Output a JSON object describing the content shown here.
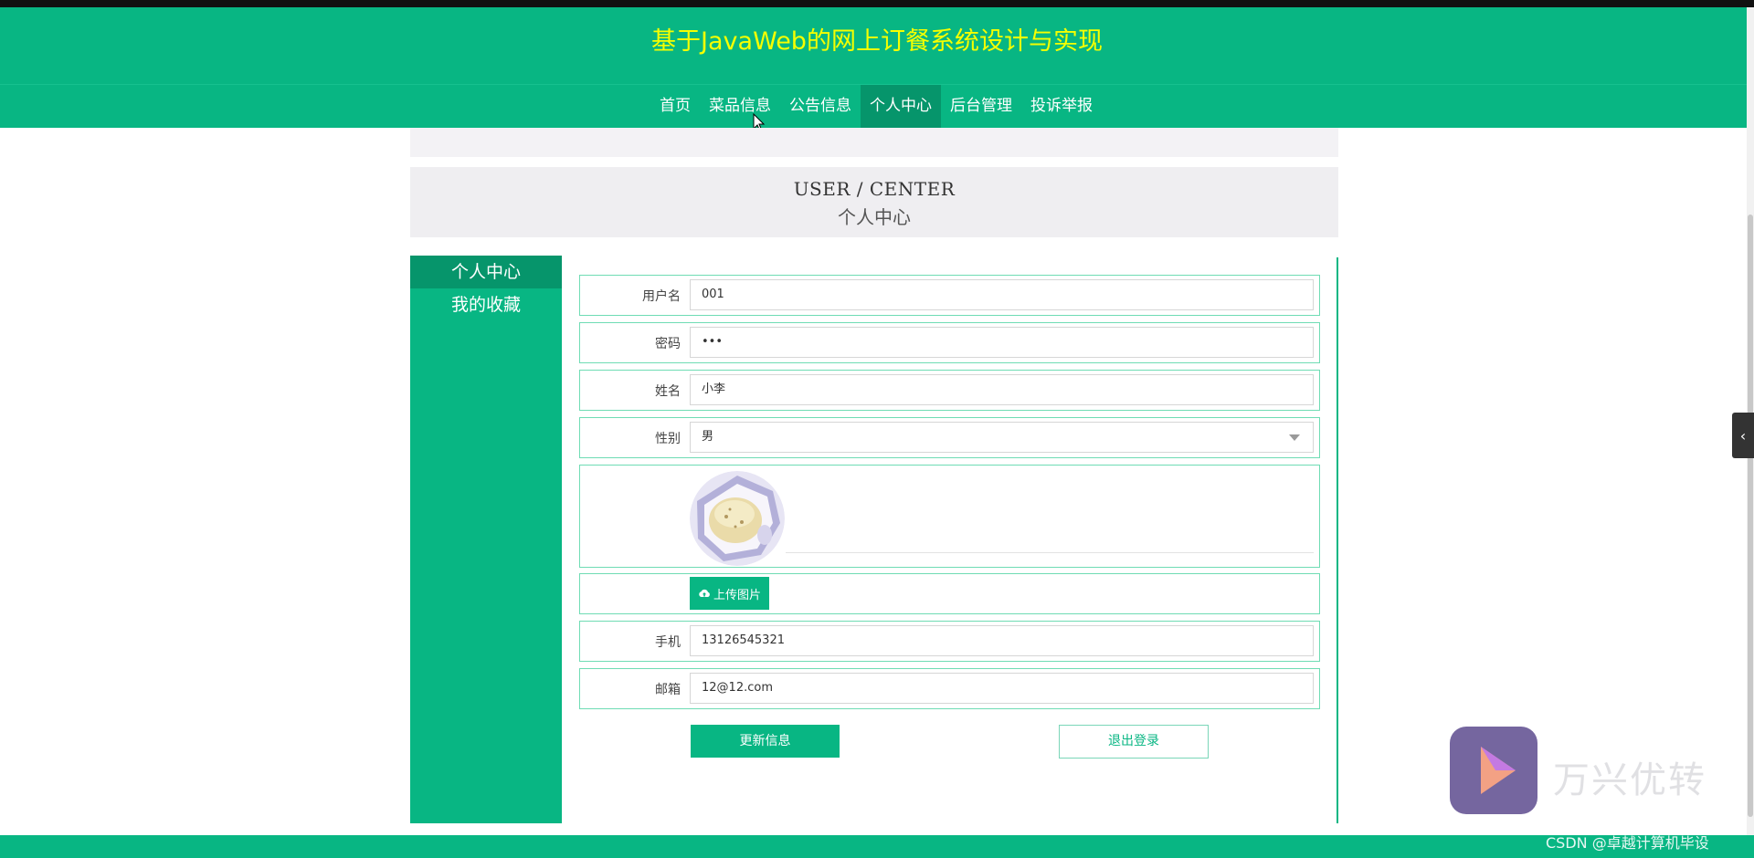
{
  "header": {
    "title": "基于JavaWeb的网上订餐系统设计与实现",
    "title_color": "#f5ff00",
    "brand_color": "#08b683"
  },
  "nav": {
    "items": [
      {
        "label": "首页",
        "active": false
      },
      {
        "label": "菜品信息",
        "active": false
      },
      {
        "label": "公告信息",
        "active": false
      },
      {
        "label": "个人中心",
        "active": true
      },
      {
        "label": "后台管理",
        "active": false
      },
      {
        "label": "投诉举报",
        "active": false
      }
    ]
  },
  "banner": {
    "en": "USER / CENTER",
    "zh": "个人中心"
  },
  "sidebar": {
    "items": [
      {
        "label": "个人中心",
        "active": true
      },
      {
        "label": "我的收藏",
        "active": false
      }
    ]
  },
  "form": {
    "username_label": "用户名",
    "username_value": "001",
    "password_label": "密码",
    "password_value": "•••",
    "name_label": "姓名",
    "name_value": "小李",
    "gender_label": "性别",
    "gender_value": "男",
    "upload_label": "上传图片",
    "phone_label": "手机",
    "phone_value": "13126545321",
    "email_label": "邮箱",
    "email_value": "12@12.com"
  },
  "actions": {
    "update_label": "更新信息",
    "logout_label": "退出登录"
  },
  "watermarks": {
    "app_text": "万兴优转",
    "csdn_text": "CSDN @卓越计算机毕设"
  },
  "icons": {
    "upload": "cloud-upload-icon",
    "collapse": "chevron-left-icon",
    "select": "chevron-down-icon"
  }
}
